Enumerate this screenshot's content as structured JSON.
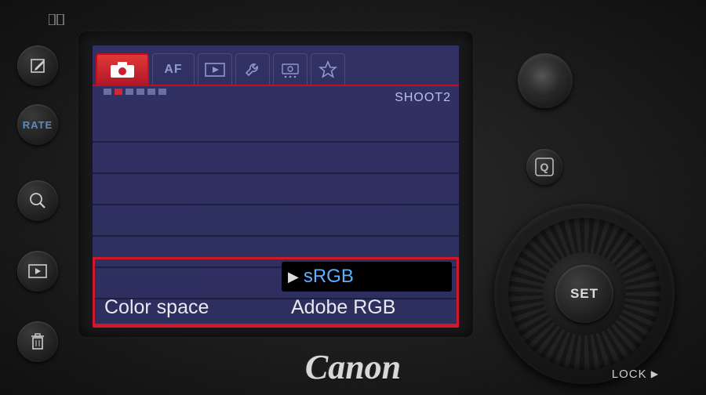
{
  "menu": {
    "tabs": [
      "camera",
      "AF",
      "play",
      "wrench",
      "camdots",
      "star"
    ],
    "active_tab": 0,
    "section_label": "SHOOT2",
    "page_dots_total": 6,
    "page_dots_active_index": 1
  },
  "setting": {
    "label": "Color space",
    "options": [
      "sRGB",
      "Adobe RGB"
    ],
    "highlighted_option": "sRGB",
    "current_value": "Adobe RGB"
  },
  "buttons": {
    "rate_label": "RATE",
    "set_label": "SET",
    "q_label": "Q",
    "lock_label": "LOCK"
  },
  "brand": "Canon",
  "icons": {
    "edit": "edit-icon",
    "zoom": "magnifier-icon",
    "playback": "play-rect-icon",
    "trash": "trash-icon",
    "compare": "compare-icon"
  }
}
